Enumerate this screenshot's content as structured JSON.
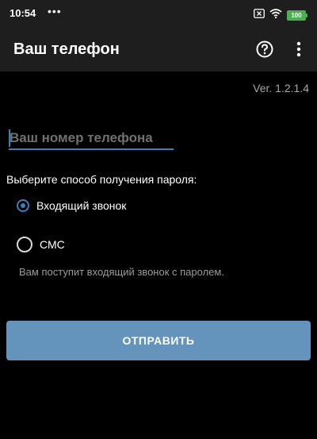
{
  "status_bar": {
    "time": "10:54",
    "dots": "•••",
    "battery_level": "100",
    "battery_color": "#4caf50"
  },
  "app_bar": {
    "title": "Ваш телефон",
    "help_icon": "help-circle-icon",
    "menu_icon": "more-vert-icon"
  },
  "version": "Ver. 1.2.1.4",
  "phone_input": {
    "value": "",
    "placeholder": "Ваш номер телефона"
  },
  "method": {
    "label": "Выберите способ получения пароля:",
    "options": [
      {
        "label": "Входящий звонок",
        "selected": true
      },
      {
        "label": "СМС",
        "selected": false
      }
    ],
    "hint": "Вам поступит входящий звонок с паролем."
  },
  "submit_label": "ОТПРАВИТЬ",
  "colors": {
    "background": "#000000",
    "bar": "#1e1e1e",
    "accent": "#3f7fb7",
    "button": "#6493bb"
  }
}
